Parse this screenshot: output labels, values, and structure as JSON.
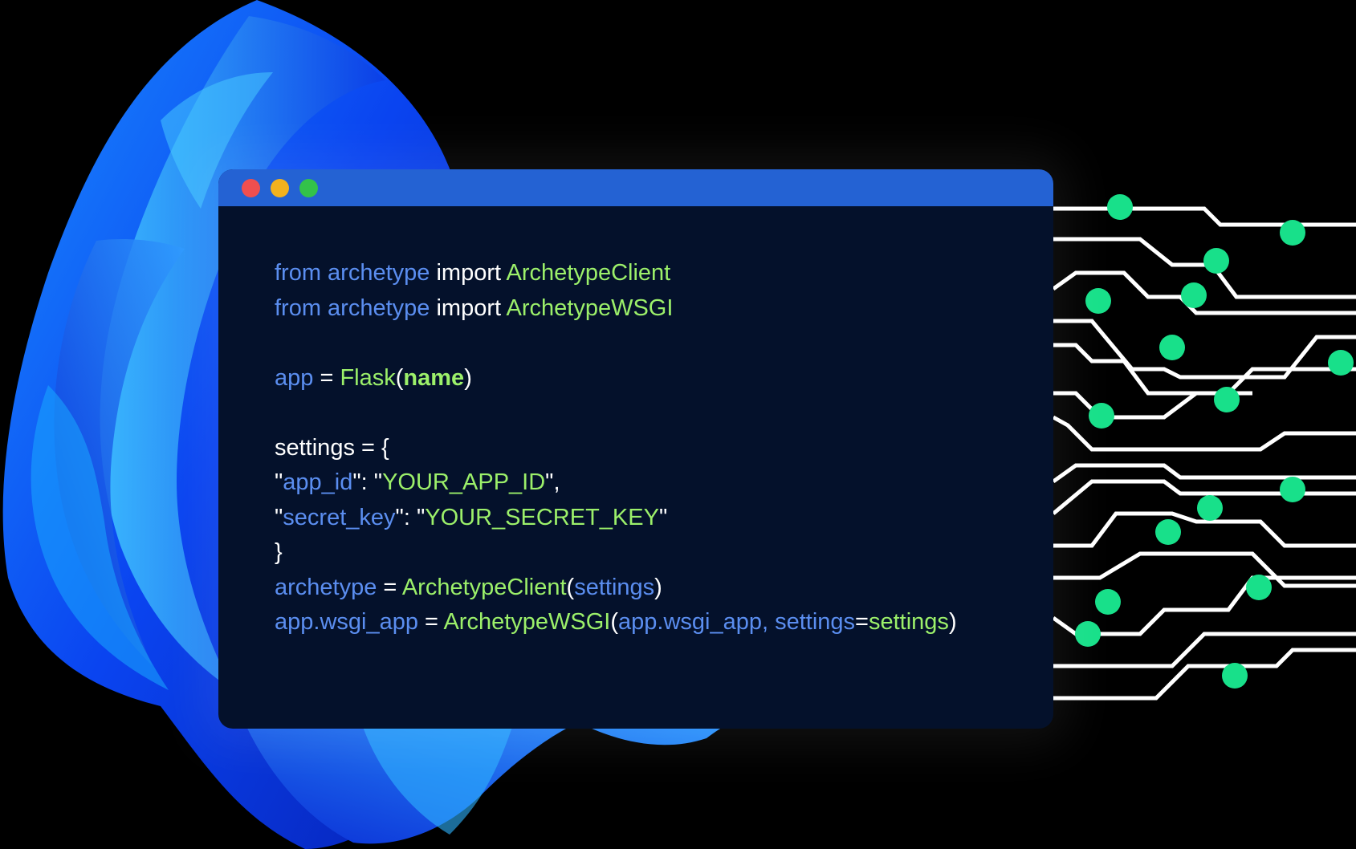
{
  "window": {
    "controls": {
      "close_color": "#ef4f4f",
      "minimize_color": "#f3b21e",
      "maximize_color": "#33c24a"
    }
  },
  "colors": {
    "background": "#000000",
    "titlebar": "#2462d3",
    "editor": "#04112b",
    "keyword_blue": "#5b8ef0",
    "identifier_green": "#9cf06a",
    "circuit_node": "#18e08a"
  },
  "code": {
    "lines": [
      [
        {
          "t": "from archetype",
          "c": "blue"
        },
        {
          "t": " import ",
          "c": "white"
        },
        {
          "t": "ArchetypeClient",
          "c": "green"
        }
      ],
      [
        {
          "t": "from archetype",
          "c": "blue"
        },
        {
          "t": " import ",
          "c": "white"
        },
        {
          "t": "ArchetypeWSGI",
          "c": "green"
        }
      ],
      [],
      [
        {
          "t": "app",
          "c": "blue"
        },
        {
          "t": " = ",
          "c": "white"
        },
        {
          "t": "Flask",
          "c": "green"
        },
        {
          "t": "(",
          "c": "white"
        },
        {
          "t": "name",
          "c": "bold"
        },
        {
          "t": ")",
          "c": "white"
        }
      ],
      [],
      [
        {
          "t": "settings = {",
          "c": "white"
        }
      ],
      [
        {
          "t": "\"",
          "c": "white"
        },
        {
          "t": "app_id",
          "c": "blue"
        },
        {
          "t": "\": \"",
          "c": "white"
        },
        {
          "t": "YOUR_APP_ID",
          "c": "green"
        },
        {
          "t": "\",",
          "c": "white"
        }
      ],
      [
        {
          "t": "\"",
          "c": "white"
        },
        {
          "t": "secret_key",
          "c": "blue"
        },
        {
          "t": "\": \"",
          "c": "white"
        },
        {
          "t": "YOUR_SECRET_KEY",
          "c": "green"
        },
        {
          "t": "\"",
          "c": "white"
        }
      ],
      [
        {
          "t": "}",
          "c": "white"
        }
      ],
      [
        {
          "t": "archetype",
          "c": "blue"
        },
        {
          "t": " = ",
          "c": "white"
        },
        {
          "t": "ArchetypeClient",
          "c": "green"
        },
        {
          "t": "(",
          "c": "white"
        },
        {
          "t": "settings",
          "c": "blue"
        },
        {
          "t": ")",
          "c": "white"
        }
      ],
      [
        {
          "t": "app.wsgi_app",
          "c": "blue"
        },
        {
          "t": " = ",
          "c": "white"
        },
        {
          "t": "ArchetypeWSGI",
          "c": "green"
        },
        {
          "t": "(",
          "c": "white"
        },
        {
          "t": "app.wsgi_app, settings",
          "c": "blue"
        },
        {
          "t": "=",
          "c": "white"
        },
        {
          "t": "settings",
          "c": "green"
        },
        {
          "t": ")",
          "c": "white"
        }
      ]
    ]
  }
}
